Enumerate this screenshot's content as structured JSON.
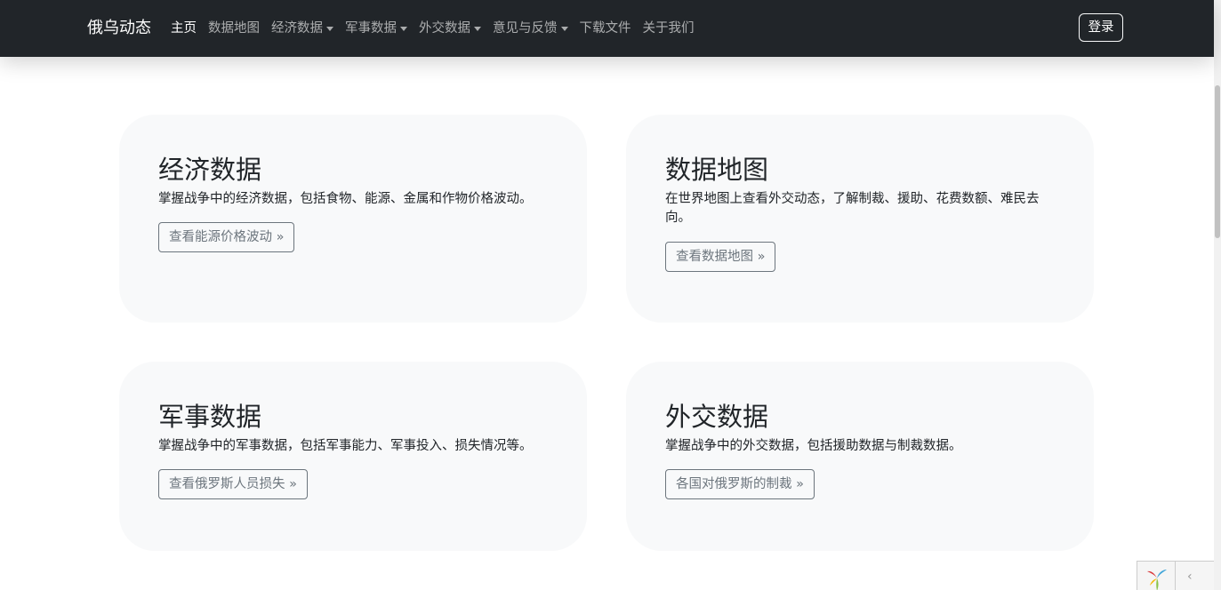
{
  "navbar": {
    "brand": "俄乌动态",
    "links": [
      {
        "label": "主页",
        "active": true,
        "dropdown": false
      },
      {
        "label": "数据地图",
        "active": false,
        "dropdown": false
      },
      {
        "label": "经济数据",
        "active": false,
        "dropdown": true
      },
      {
        "label": "军事数据",
        "active": false,
        "dropdown": true
      },
      {
        "label": "外交数据",
        "active": false,
        "dropdown": true
      },
      {
        "label": "意见与反馈",
        "active": false,
        "dropdown": true
      },
      {
        "label": "下载文件",
        "active": false,
        "dropdown": false
      },
      {
        "label": "关于我们",
        "active": false,
        "dropdown": false
      }
    ],
    "login_label": "登录"
  },
  "cards": [
    {
      "title": "经济数据",
      "text": "掌握战争中的经济数据，包括食物、能源、金属和作物价格波动。",
      "button": "查看能源价格波动 »"
    },
    {
      "title": "数据地图",
      "text": "在世界地图上查看外交动态，了解制裁、援助、花费数额、难民去向。",
      "button": "查看数据地图 »"
    },
    {
      "title": "军事数据",
      "text": "掌握战争中的军事数据，包括军事能力、军事投入、损失情况等。",
      "button": "查看俄罗斯人员损失 »"
    },
    {
      "title": "外交数据",
      "text": "掌握战争中的外交数据，包括援助数据与制裁数据。",
      "button": "各国对俄罗斯的制裁 »"
    }
  ],
  "debug_toolbar": {
    "toggle_glyph": "‹",
    "logo_icon": "yii-logo-icon"
  },
  "colors": {
    "navbar_bg": "#212529",
    "card_bg": "#f8f9fa",
    "button_border": "#6c757d"
  }
}
